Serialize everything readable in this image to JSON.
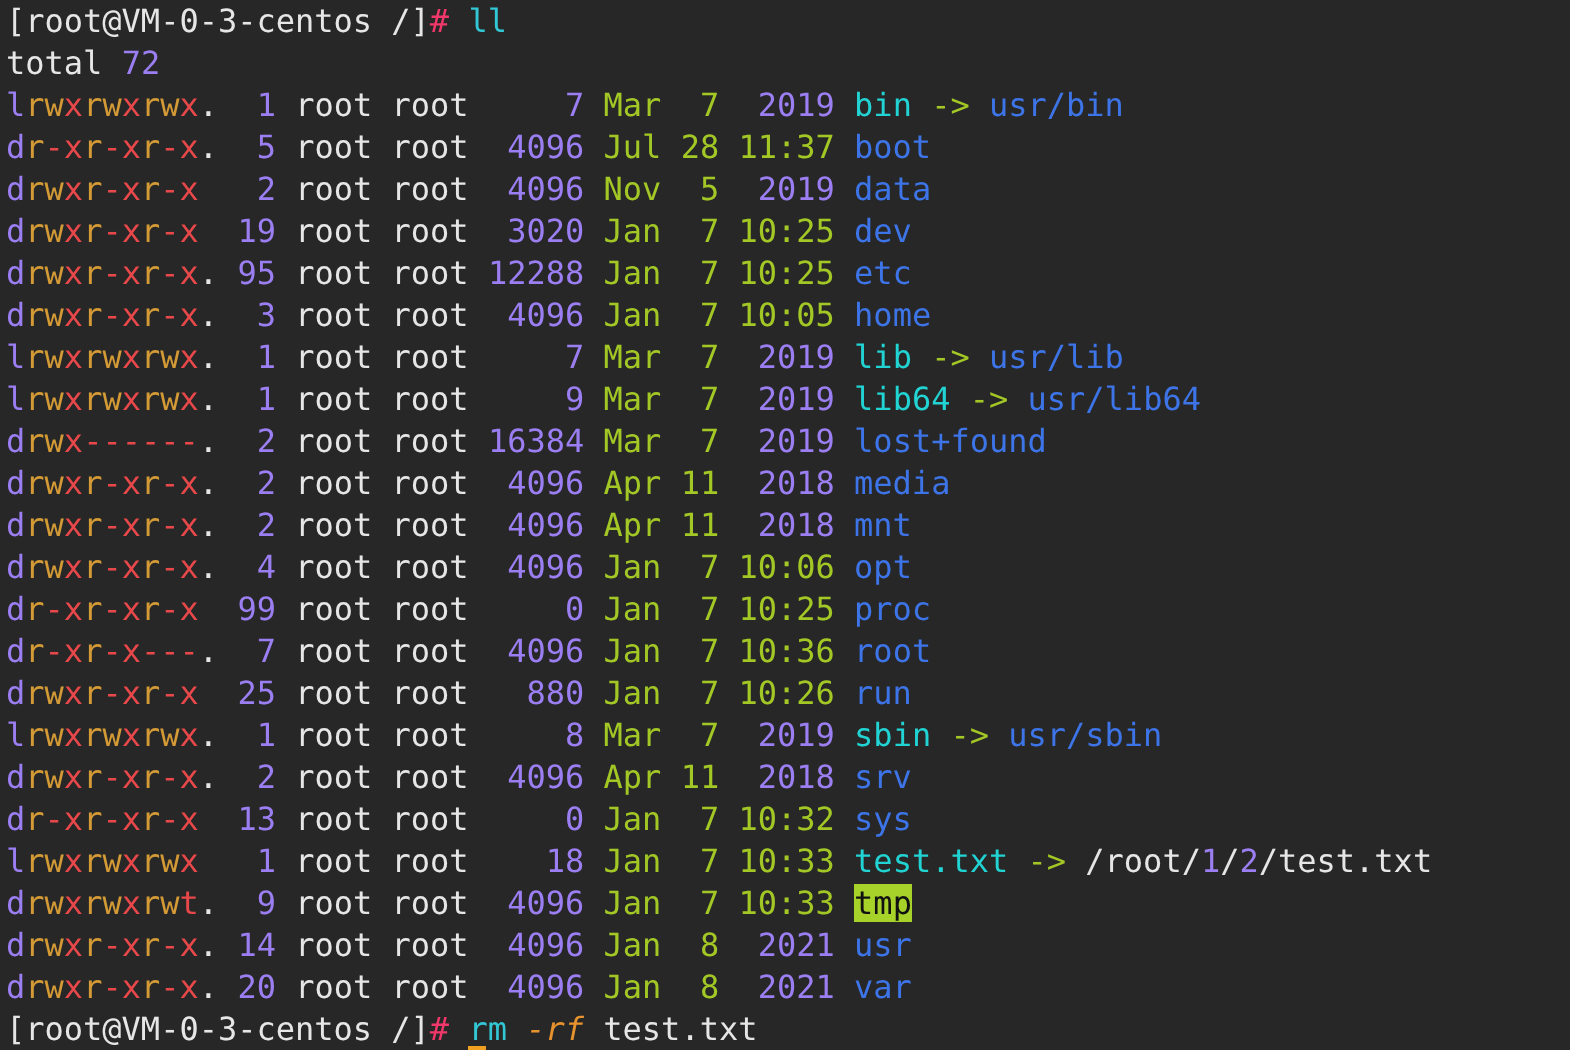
{
  "prompt1": {
    "prompt": "[root@VM-0-3-centos /]",
    "symbol": "#",
    "program": "ll"
  },
  "total": {
    "label": "total",
    "count": "72"
  },
  "entries": [
    {
      "perms": "lrwxrwxrwx.",
      "links": "1",
      "owner": "root",
      "group": "root",
      "size": "7",
      "month": "Mar",
      "day": "7",
      "time": "2019",
      "name": "bin",
      "kind": "link",
      "arrow": "->",
      "target": "usr/bin"
    },
    {
      "perms": "dr-xr-xr-x.",
      "links": "5",
      "owner": "root",
      "group": "root",
      "size": "4096",
      "month": "Jul",
      "day": "28",
      "time": "11:37",
      "name": "boot",
      "kind": "dir"
    },
    {
      "perms": "drwxr-xr-x",
      "links": "2",
      "owner": "root",
      "group": "root",
      "size": "4096",
      "month": "Nov",
      "day": "5",
      "time": "2019",
      "name": "data",
      "kind": "dir"
    },
    {
      "perms": "drwxr-xr-x",
      "links": "19",
      "owner": "root",
      "group": "root",
      "size": "3020",
      "month": "Jan",
      "day": "7",
      "time": "10:25",
      "name": "dev",
      "kind": "dir"
    },
    {
      "perms": "drwxr-xr-x.",
      "links": "95",
      "owner": "root",
      "group": "root",
      "size": "12288",
      "month": "Jan",
      "day": "7",
      "time": "10:25",
      "name": "etc",
      "kind": "dir"
    },
    {
      "perms": "drwxr-xr-x.",
      "links": "3",
      "owner": "root",
      "group": "root",
      "size": "4096",
      "month": "Jan",
      "day": "7",
      "time": "10:05",
      "name": "home",
      "kind": "dir"
    },
    {
      "perms": "lrwxrwxrwx.",
      "links": "1",
      "owner": "root",
      "group": "root",
      "size": "7",
      "month": "Mar",
      "day": "7",
      "time": "2019",
      "name": "lib",
      "kind": "link",
      "arrow": "->",
      "target": "usr/lib"
    },
    {
      "perms": "lrwxrwxrwx.",
      "links": "1",
      "owner": "root",
      "group": "root",
      "size": "9",
      "month": "Mar",
      "day": "7",
      "time": "2019",
      "name": "lib64",
      "kind": "link",
      "arrow": "->",
      "target": "usr/lib64"
    },
    {
      "perms": "drwx------.",
      "links": "2",
      "owner": "root",
      "group": "root",
      "size": "16384",
      "month": "Mar",
      "day": "7",
      "time": "2019",
      "name": "lost+found",
      "kind": "dir"
    },
    {
      "perms": "drwxr-xr-x.",
      "links": "2",
      "owner": "root",
      "group": "root",
      "size": "4096",
      "month": "Apr",
      "day": "11",
      "time": "2018",
      "name": "media",
      "kind": "dir"
    },
    {
      "perms": "drwxr-xr-x.",
      "links": "2",
      "owner": "root",
      "group": "root",
      "size": "4096",
      "month": "Apr",
      "day": "11",
      "time": "2018",
      "name": "mnt",
      "kind": "dir"
    },
    {
      "perms": "drwxr-xr-x.",
      "links": "4",
      "owner": "root",
      "group": "root",
      "size": "4096",
      "month": "Jan",
      "day": "7",
      "time": "10:06",
      "name": "opt",
      "kind": "dir"
    },
    {
      "perms": "dr-xr-xr-x",
      "links": "99",
      "owner": "root",
      "group": "root",
      "size": "0",
      "month": "Jan",
      "day": "7",
      "time": "10:25",
      "name": "proc",
      "kind": "dir"
    },
    {
      "perms": "dr-xr-x---.",
      "links": "7",
      "owner": "root",
      "group": "root",
      "size": "4096",
      "month": "Jan",
      "day": "7",
      "time": "10:36",
      "name": "root",
      "kind": "dir"
    },
    {
      "perms": "drwxr-xr-x",
      "links": "25",
      "owner": "root",
      "group": "root",
      "size": "880",
      "month": "Jan",
      "day": "7",
      "time": "10:26",
      "name": "run",
      "kind": "dir"
    },
    {
      "perms": "lrwxrwxrwx.",
      "links": "1",
      "owner": "root",
      "group": "root",
      "size": "8",
      "month": "Mar",
      "day": "7",
      "time": "2019",
      "name": "sbin",
      "kind": "link",
      "arrow": "->",
      "target": "usr/sbin"
    },
    {
      "perms": "drwxr-xr-x.",
      "links": "2",
      "owner": "root",
      "group": "root",
      "size": "4096",
      "month": "Apr",
      "day": "11",
      "time": "2018",
      "name": "srv",
      "kind": "dir"
    },
    {
      "perms": "dr-xr-xr-x",
      "links": "13",
      "owner": "root",
      "group": "root",
      "size": "0",
      "month": "Jan",
      "day": "7",
      "time": "10:32",
      "name": "sys",
      "kind": "dir"
    },
    {
      "perms": "lrwxrwxrwx",
      "links": "1",
      "owner": "root",
      "group": "root",
      "size": "18",
      "month": "Jan",
      "day": "7",
      "time": "10:33",
      "name": "test.txt",
      "kind": "link",
      "arrow": "->",
      "target": "/root/1/2/test.txt"
    },
    {
      "perms": "drwxrwxrwt.",
      "links": "9",
      "owner": "root",
      "group": "root",
      "size": "4096",
      "month": "Jan",
      "day": "7",
      "time": "10:33",
      "name": "tmp",
      "kind": "sticky"
    },
    {
      "perms": "drwxr-xr-x.",
      "links": "14",
      "owner": "root",
      "group": "root",
      "size": "4096",
      "month": "Jan",
      "day": "8",
      "time": "2021",
      "name": "usr",
      "kind": "dir"
    },
    {
      "perms": "drwxr-xr-x.",
      "links": "20",
      "owner": "root",
      "group": "root",
      "size": "4096",
      "month": "Jan",
      "day": "8",
      "time": "2021",
      "name": "var",
      "kind": "dir"
    }
  ],
  "prompt2": {
    "prompt": "[root@VM-0-3-centos /]",
    "symbol": "#",
    "program": "rm",
    "flag": "-rf",
    "argument": "test.txt"
  }
}
